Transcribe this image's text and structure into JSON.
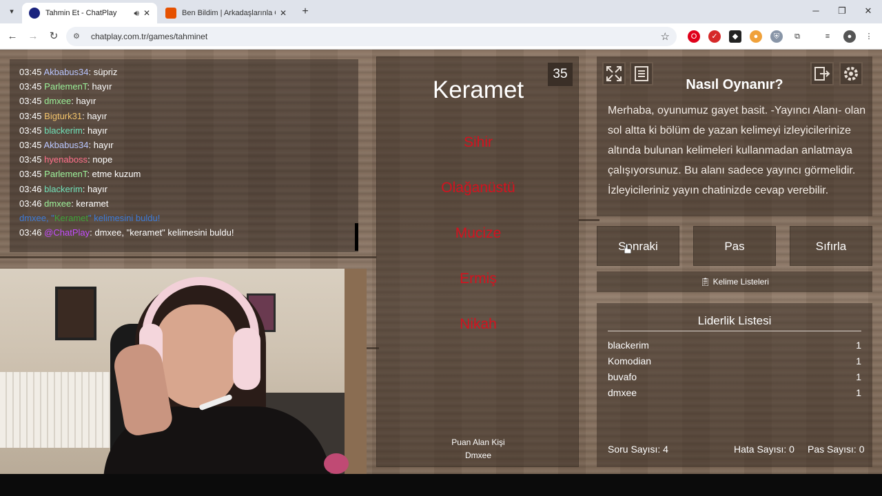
{
  "browser": {
    "tabs": [
      {
        "title": "Tahmin Et - ChatPlay"
      },
      {
        "title": "Ben Bildim | Arkadaşlarınla Onli"
      }
    ],
    "url": "chatplay.com.tr/games/tahminet"
  },
  "chat": {
    "messages": [
      {
        "time": "03:45",
        "user": "Akbabus34",
        "color": "#b9c6ff",
        "text": ": süpriz"
      },
      {
        "time": "03:45",
        "user": "ParlemenT",
        "color": "#9cf29a",
        "text": ": hayır"
      },
      {
        "time": "03:45",
        "user": "dmxee",
        "color": "#9cf29a",
        "text": ": hayır"
      },
      {
        "time": "03:45",
        "user": "Bigturk31",
        "color": "#f2c36b",
        "text": ": hayır"
      },
      {
        "time": "03:45",
        "user": "blackerim",
        "color": "#6fe0b8",
        "text": ": hayır"
      },
      {
        "time": "03:45",
        "user": "Akbabus34",
        "color": "#b9c6ff",
        "text": ": hayır"
      },
      {
        "time": "03:45",
        "user": "hyenaboss",
        "color": "#ff6f8a",
        "text": ": nope"
      },
      {
        "time": "03:45",
        "user": "ParlemenT",
        "color": "#9cf29a",
        "text": ": etme kuzum"
      },
      {
        "time": "03:46",
        "user": "blackerim",
        "color": "#6fe0b8",
        "text": ": hayır"
      },
      {
        "time": "03:46",
        "user": "dmxee",
        "color": "#9cf29a",
        "text": ": keramet"
      }
    ],
    "system_line": {
      "prefix": "dmxee, \"",
      "word": "Keramet",
      "suffix": "\" kelimesini buldu!"
    },
    "final_line": {
      "time": "03:46",
      "user": "@ChatPlay",
      "text": ": dmxee, \"keramet\" kelimesini buldu!"
    }
  },
  "game": {
    "timer": "35",
    "word": "Keramet",
    "taboo_words": [
      "Sihir",
      "Olağanüstü",
      "Mucize",
      "Ermiş",
      "Nikah"
    ],
    "scorer_label": "Puan Alan Kişi",
    "scorer_name": "Dmxee"
  },
  "howto": {
    "title": "Nasıl Oynanır?",
    "text": "Merhaba, oyunumuz gayet basit. -Yayıncı Alanı- olan sol altta ki bölüm de yazan kelimeyi izleyicilerinize altında bulunan kelimeleri kullanmadan anlatmaya çalışıyorsunuz. Bu alanı sadece yayıncı görmelidir. İzleyicileriniz yayın chatinizde cevap verebilir."
  },
  "actions": {
    "next": "Sonraki",
    "pass": "Pas",
    "reset": "Sıfırla"
  },
  "word_lists": "Kelime Listeleri",
  "leaderboard": {
    "title": "Liderlik Listesi",
    "rows": [
      {
        "name": "blackerim",
        "score": "1"
      },
      {
        "name": "Komodian",
        "score": "1"
      },
      {
        "name": "buvafo",
        "score": "1"
      },
      {
        "name": "dmxee",
        "score": "1"
      }
    ]
  },
  "stats": {
    "questions": "Soru Sayısı: 4",
    "errors": "Hata Sayısı: 0",
    "passes": "Pas Sayısı: 0"
  },
  "colors": {
    "taboo": "#d4121f",
    "system_blue": "#3d7bd8",
    "system_green": "#3fa23a",
    "chatplay": "#c44dff"
  }
}
